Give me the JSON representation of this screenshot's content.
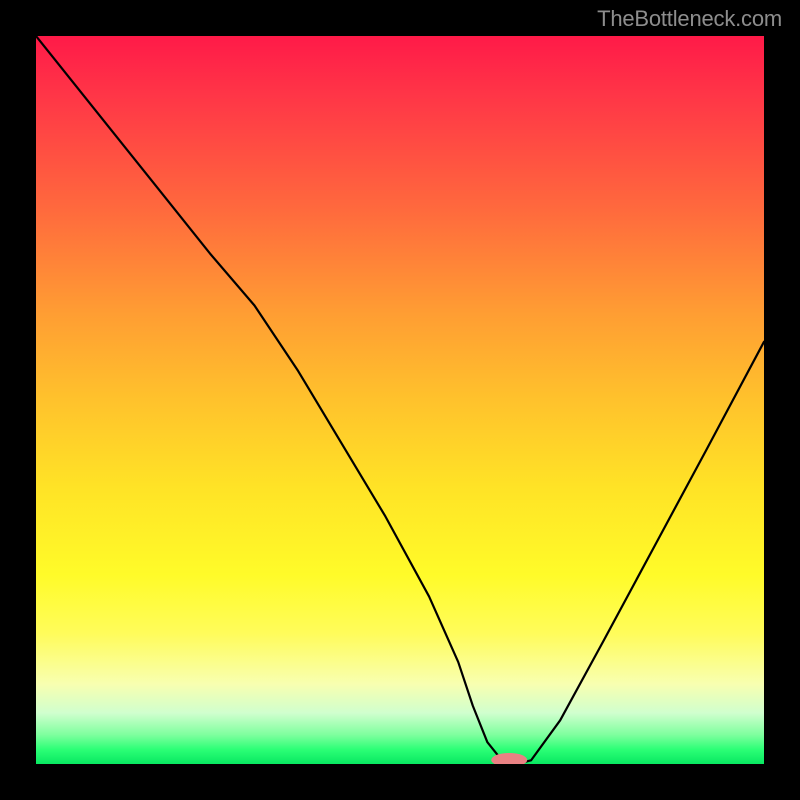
{
  "watermark_text": "TheBottleneck.com",
  "chart_data": {
    "type": "line",
    "title": "",
    "xlabel": "",
    "ylabel": "",
    "xlim": [
      0,
      100
    ],
    "ylim": [
      0,
      100
    ],
    "grid": false,
    "series": [
      {
        "name": "bottleneck-curve",
        "x": [
          0,
          8,
          16,
          24,
          30,
          36,
          42,
          48,
          54,
          58,
          60,
          62,
          64,
          65,
          66,
          68,
          72,
          78,
          85,
          92,
          100
        ],
        "values": [
          100,
          90,
          80,
          70,
          63,
          54,
          44,
          34,
          23,
          14,
          8,
          3,
          0.5,
          0,
          0,
          0.5,
          6,
          17,
          30,
          43,
          58
        ]
      }
    ],
    "marker": {
      "name": "optimal-point",
      "x": 65,
      "y": 0,
      "color": "#e98183",
      "rx": 18,
      "ry": 7
    },
    "background_gradient_stops": [
      {
        "pos": 0,
        "color": "#ff1a48"
      },
      {
        "pos": 24,
        "color": "#ff6a3d"
      },
      {
        "pos": 50,
        "color": "#ffc22c"
      },
      {
        "pos": 74,
        "color": "#fffb29"
      },
      {
        "pos": 93,
        "color": "#d0ffce"
      },
      {
        "pos": 100,
        "color": "#08e861"
      }
    ]
  }
}
